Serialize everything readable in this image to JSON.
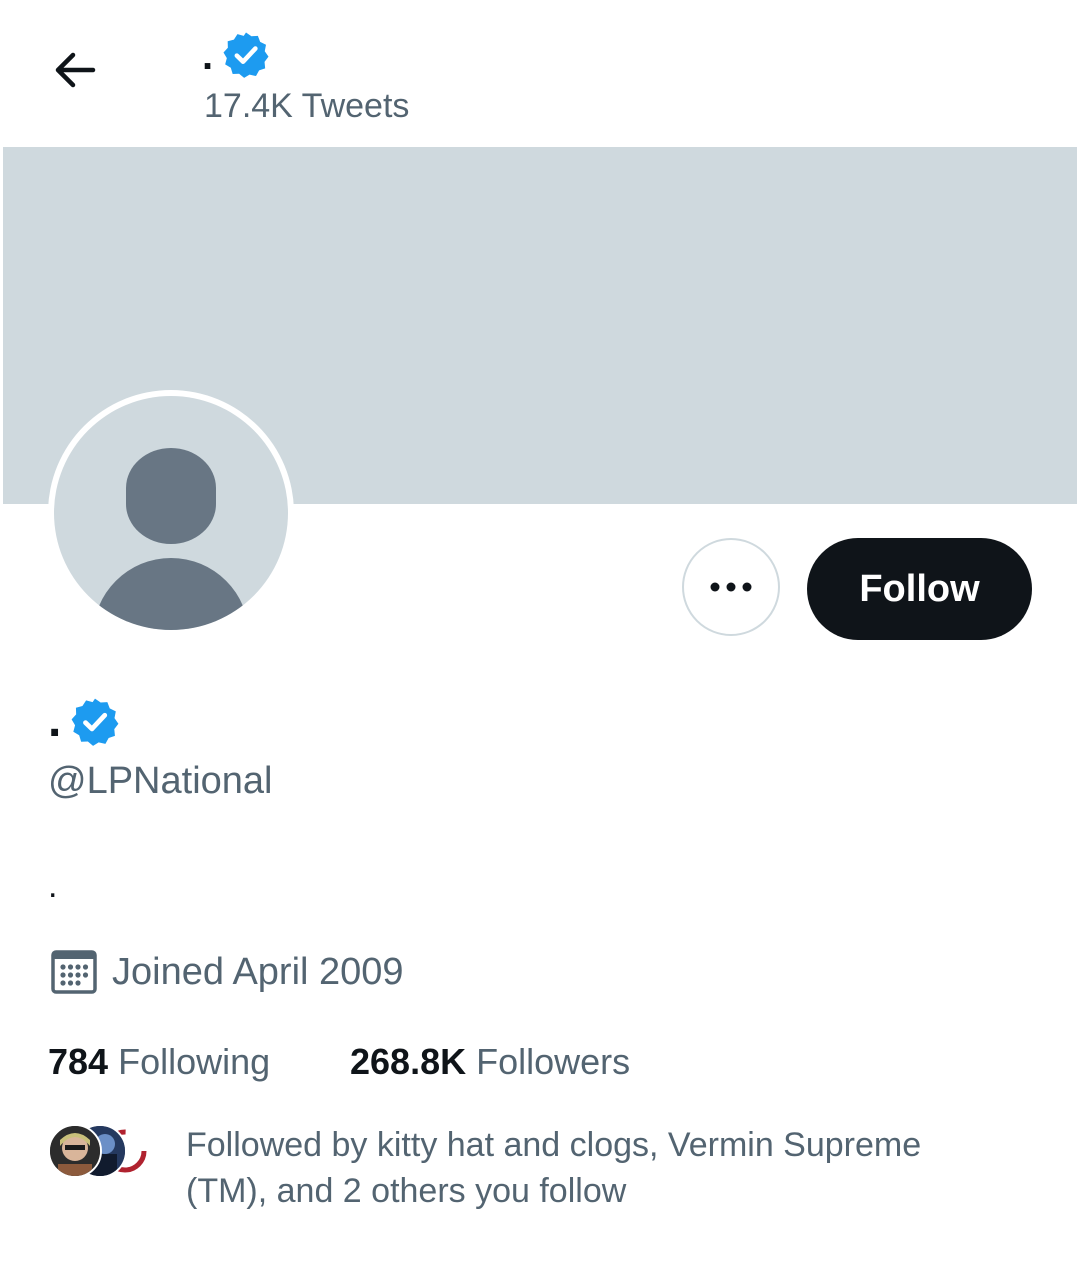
{
  "header": {
    "name": ".",
    "tweet_count": "17.4K Tweets",
    "verified": true
  },
  "actions": {
    "follow_label": "Follow",
    "more_label": "•••"
  },
  "profile": {
    "display_name": ".",
    "handle": "@LPNational",
    "bio": ".",
    "joined": "Joined April 2009",
    "following_count": "784",
    "following_label": "Following",
    "followers_count": "268.8K",
    "followers_label": "Followers",
    "followed_by": "Followed by kitty hat and clogs, Vermin Supreme (TM), and 2 others you follow"
  },
  "icons": [
    "back-arrow-icon",
    "verified-badge-icon",
    "more-options-icon",
    "calendar-icon",
    "default-avatar-icon"
  ],
  "colors": {
    "verified": "#1d9bf0",
    "banner": "#cfd9de",
    "secondary_text": "#536471",
    "primary_text": "#0f1419"
  }
}
